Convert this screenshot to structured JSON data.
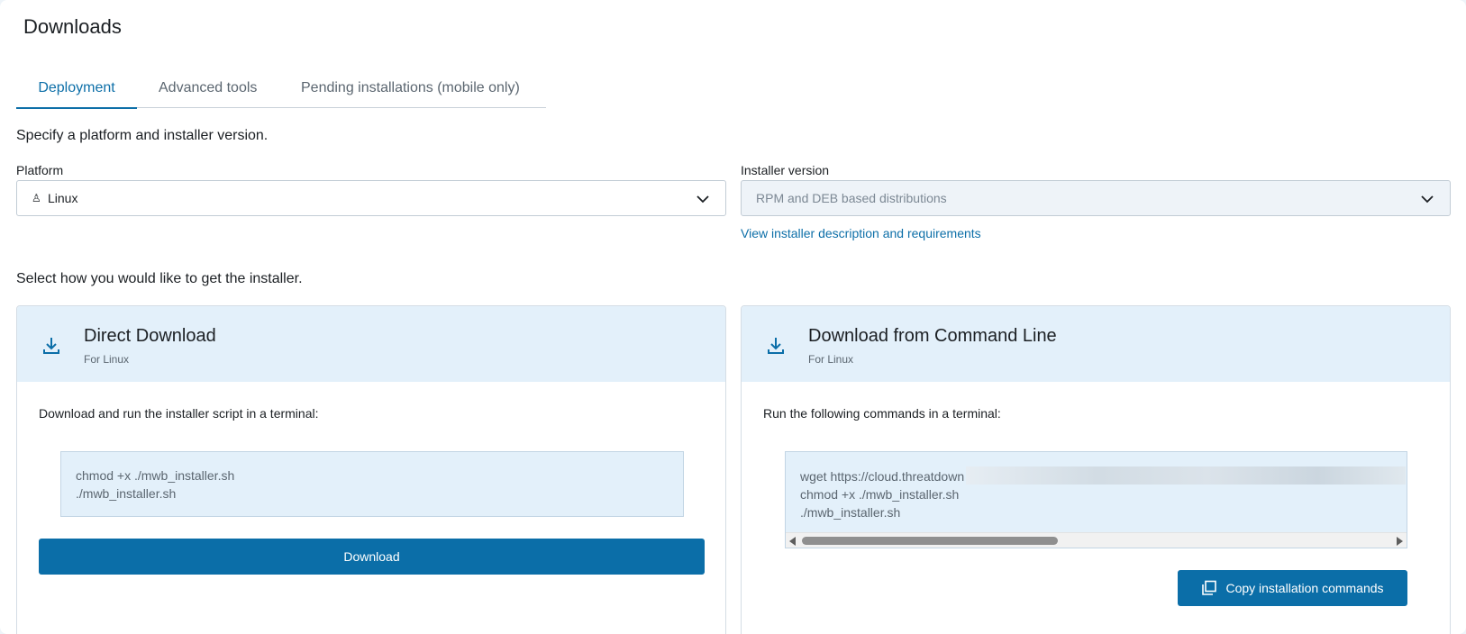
{
  "header": {
    "title": "Downloads"
  },
  "tabs": [
    {
      "label": "Deployment",
      "active": true
    },
    {
      "label": "Advanced tools",
      "active": false
    },
    {
      "label": "Pending installations (mobile only)",
      "active": false
    }
  ],
  "form": {
    "instruction": "Specify a platform and installer version.",
    "platform": {
      "label": "Platform",
      "value": "Linux",
      "icon": "linux-icon"
    },
    "installer_version": {
      "label": "Installer version",
      "value": "RPM and DEB based distributions",
      "disabled": true
    },
    "requirements_link": "View installer description and requirements"
  },
  "method_instruction": "Select how you would like to get the installer.",
  "direct_download": {
    "icon": "download-icon",
    "title": "Direct Download",
    "subtitle": "For Linux",
    "description": "Download and run the installer script in a terminal:",
    "commands": [
      "chmod +x ./mwb_installer.sh",
      "./mwb_installer.sh"
    ],
    "button_label": "Download"
  },
  "command_line": {
    "icon": "download-icon",
    "title": "Download from Command Line",
    "subtitle": "For Linux",
    "description": "Run the following commands in a terminal:",
    "commands": [
      "wget https://cloud.threatdown",
      "chmod +x ./mwb_installer.sh",
      "./mwb_installer.sh"
    ],
    "button_label": "Copy installation commands"
  },
  "colors": {
    "accent": "#0b6ea8",
    "card_header_bg": "#e3f0fa",
    "tab_active": "#0d6fa8"
  }
}
